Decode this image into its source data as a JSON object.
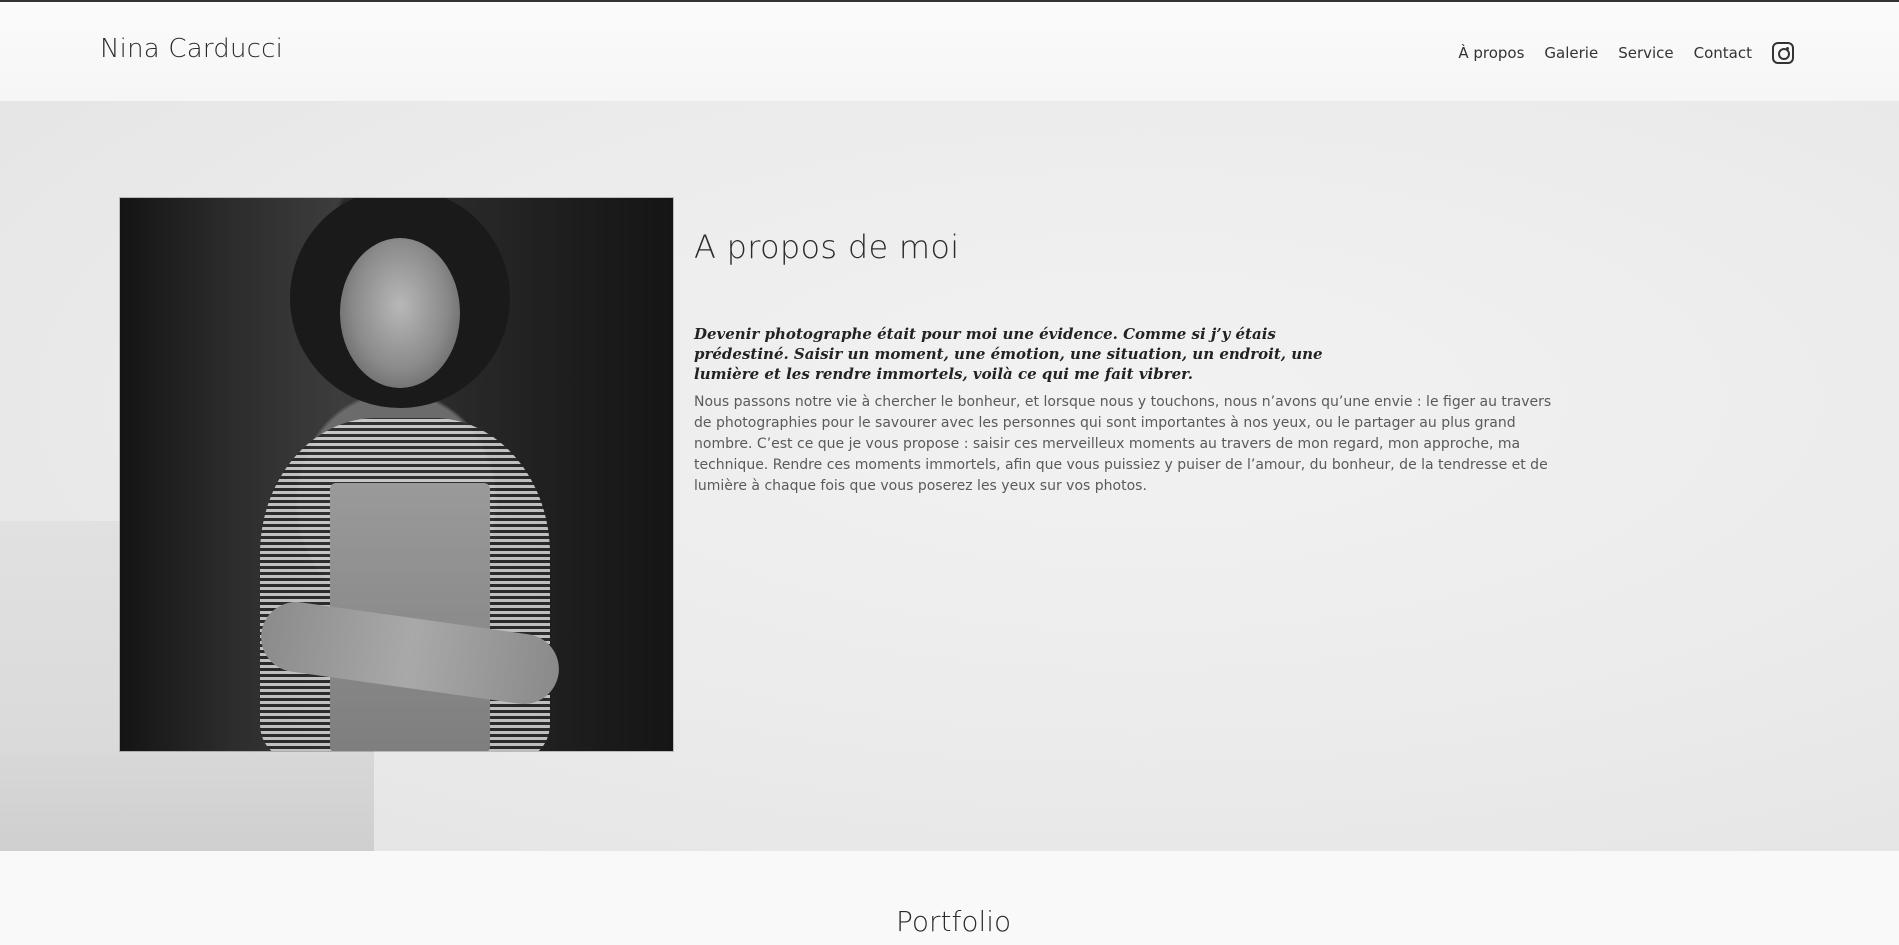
{
  "header": {
    "brand": "Nina Carducci",
    "nav": [
      "À propos",
      "Galerie",
      "Service",
      "Contact"
    ],
    "instagram_icon": "instagram-icon"
  },
  "about": {
    "title": "A propos de moi",
    "lead": "Devenir photographe était pour moi une évidence. Comme si j’y étais prédestiné. Saisir un moment, une émotion, une situation, un endroit, une lumière et les rendre immortels, voilà ce qui me fait vibrer.",
    "body": "Nous passons notre vie à chercher le bonheur, et lorsque nous y touchons, nous n’avons qu’une envie : le figer au travers de photographies pour le savourer avec les personnes qui sont importantes à nos yeux, ou le partager au plus grand nombre. C’est ce que je vous propose : saisir ces merveilleux moments au travers de mon regard, mon approche, ma technique. Rendre ces moments immortels, afin que vous puissiez y puiser de l’amour, du bonheur, de la tendresse et de lumière à chaque fois que vous poserez les yeux sur vos photos."
  },
  "portfolio": {
    "title": "Portfolio"
  }
}
